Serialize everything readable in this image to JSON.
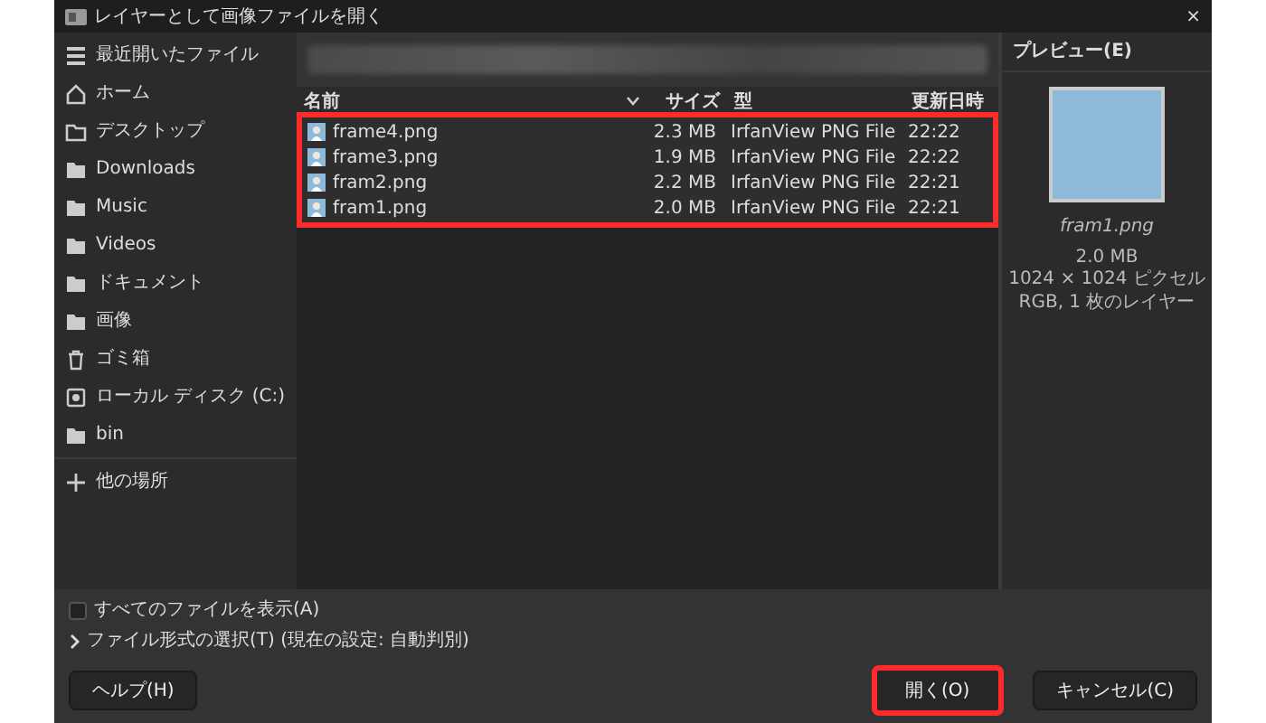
{
  "window": {
    "title": "レイヤーとして画像ファイルを開く",
    "close": "×"
  },
  "sidebar": {
    "items": [
      {
        "label": "最近開いたファイル",
        "kind": "recent"
      },
      {
        "label": "ホーム",
        "kind": "home"
      },
      {
        "label": "デスクトップ",
        "kind": "outline-folder"
      },
      {
        "label": "Downloads",
        "kind": "folder"
      },
      {
        "label": "Music",
        "kind": "folder"
      },
      {
        "label": "Videos",
        "kind": "folder"
      },
      {
        "label": "ドキュメント",
        "kind": "folder"
      },
      {
        "label": "画像",
        "kind": "folder"
      },
      {
        "label": "ゴミ箱",
        "kind": "trash"
      },
      {
        "label": "ローカル ディスク (C:)",
        "kind": "disk"
      },
      {
        "label": "bin",
        "kind": "folder"
      }
    ],
    "other_locations": "他の場所"
  },
  "file_list": {
    "columns": [
      "名前",
      "サイズ",
      "型",
      "更新日時"
    ],
    "highlighted": true,
    "rows": [
      {
        "name": "frame4.png",
        "size": "2.3 MB",
        "type": "IrfanView PNG File",
        "modified": "22:22"
      },
      {
        "name": "frame3.png",
        "size": "1.9 MB",
        "type": "IrfanView PNG File",
        "modified": "22:22"
      },
      {
        "name": "fram2.png",
        "size": "2.2 MB",
        "type": "IrfanView PNG File",
        "modified": "22:21"
      },
      {
        "name": "fram1.png",
        "size": "2.0 MB",
        "type": "IrfanView PNG File",
        "modified": "22:21"
      }
    ]
  },
  "preview": {
    "title": "プレビュー(E)",
    "filename": "fram1.png",
    "details": [
      "2.0 MB",
      "1024 × 1024 ピクセル",
      "RGB, 1 枚のレイヤー"
    ]
  },
  "show_all_files": {
    "label": "すべてのファイルを表示(A)",
    "checked": false
  },
  "file_type": {
    "label": "ファイル形式の選択(T) (現在の設定: 自動判別)",
    "expanded": false
  },
  "buttons": [
    {
      "label": "ヘルプ(H)",
      "kind": "help",
      "highlighted": false
    },
    {
      "label": "開く(O)",
      "kind": "open",
      "highlighted": true
    },
    {
      "label": "キャンセル(C)",
      "kind": "cancel",
      "highlighted": false
    }
  ]
}
